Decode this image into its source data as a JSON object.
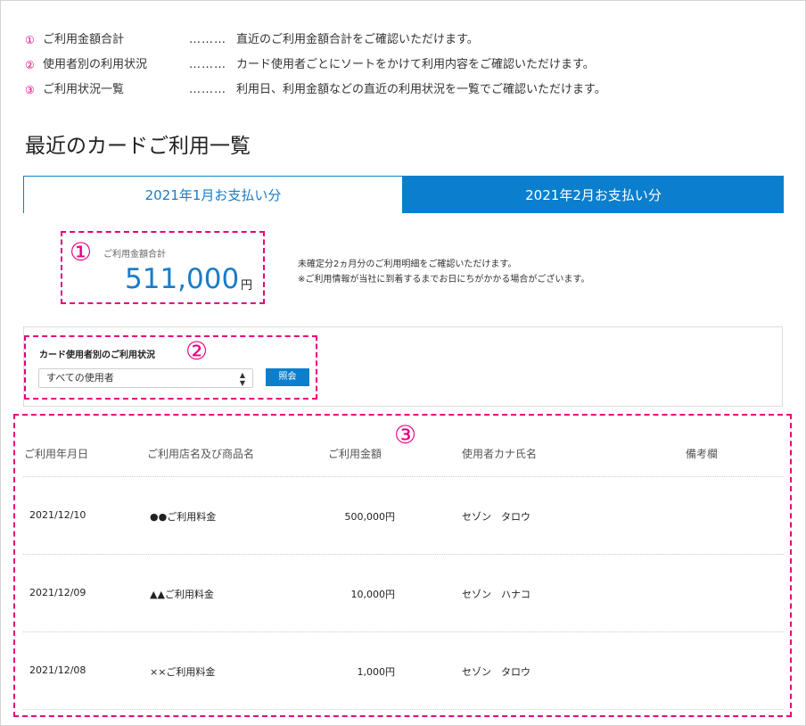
{
  "legend": [
    {
      "num": "①",
      "title": "ご利用金額合計",
      "dots": "………",
      "desc": "直近のご利用金額合計をご確認いただけます。"
    },
    {
      "num": "②",
      "title": "使用者別の利用状況",
      "dots": "………",
      "desc": "カード使用者ごとにソートをかけて利用内容をご確認いただけます。"
    },
    {
      "num": "③",
      "title": "ご利用状況一覧",
      "dots": "………",
      "desc": "利用日、利用金額などの直近の利用状況を一覧でご確認いただけます。"
    }
  ],
  "page_title": "最近のカードご利用一覧",
  "tabs": [
    {
      "label": "2021年1月お支払い分"
    },
    {
      "label": "2021年2月お支払い分"
    }
  ],
  "total": {
    "callout": "①",
    "label": "ご利用金額合計",
    "amount": "511,000",
    "unit": "円"
  },
  "note": {
    "line1": "未確定分2ヵ月分のご利用明細をご確認いただけます。",
    "line2": "※ご利用情報が当社に到着するまでお日にちがかかる場合がございます。"
  },
  "filter": {
    "callout": "②",
    "label": "カード使用者別のご利用状況",
    "selected": "すべての使用者",
    "button": "照会"
  },
  "table": {
    "callout": "③",
    "headers": [
      "ご利用年月日",
      "ご利用店名及び商品名",
      "ご利用金額",
      "使用者カナ氏名",
      "備考欄"
    ],
    "rows": [
      {
        "date": "2021/12/10",
        "store": "●●ご利用料金",
        "amount": "500,000円",
        "user": "セゾン　タロウ",
        "remarks": ""
      },
      {
        "date": "2021/12/09",
        "store": "▲▲ご利用料金",
        "amount": "10,000円",
        "user": "セゾン　ハナコ",
        "remarks": ""
      },
      {
        "date": "2021/12/08",
        "store": "××ご利用料金",
        "amount": "1,000円",
        "user": "セゾン　タロウ",
        "remarks": ""
      }
    ]
  },
  "colors": {
    "accent": "#0b7fce",
    "highlight": "#e4007f"
  }
}
